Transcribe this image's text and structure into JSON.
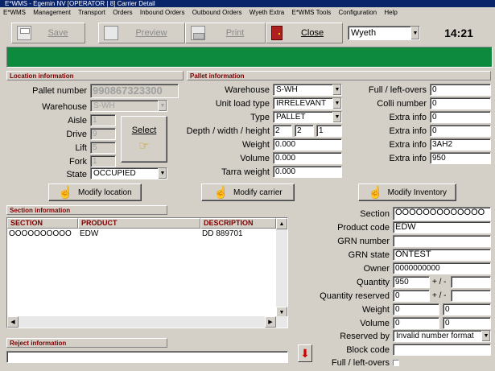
{
  "window": {
    "title": "E*WMS - Egemin NV [OPERATOR | 8] Carrier Detail"
  },
  "menu": [
    "E*WMS",
    "Management",
    "Transport",
    "Orders",
    "Inbound Orders",
    "Outbound Orders",
    "Wyeth Extra",
    "E*WMS Tools",
    "Configuration",
    "Help"
  ],
  "toolbar": {
    "save": "Save",
    "preview": "Preview",
    "print": "Print",
    "close": "Close",
    "client_value": "Wyeth",
    "clock": "14:21"
  },
  "location": {
    "title": "Location information",
    "pallet_number_label": "Pallet number",
    "pallet_number": "990867323300",
    "warehouse_label": "Warehouse",
    "warehouse": "S-WH",
    "aisle_label": "Aisle",
    "aisle": "1",
    "drive_label": "Drive",
    "drive": "9",
    "lift_label": "Lift",
    "lift": "5",
    "fork_label": "Fork",
    "fork": "1",
    "state_label": "State",
    "state": "OCCUPIED",
    "select_label": "Select"
  },
  "pallet": {
    "title": "Pallet information",
    "warehouse_label": "Warehouse",
    "warehouse": "S-WH",
    "unit_load_type_label": "Unit load type",
    "unit_load_type": "IRRELEVANT",
    "type_label": "Type",
    "type": "PALLET",
    "dims_label": "Depth / width / height",
    "depth": "2",
    "width": "2",
    "height": "1",
    "weight_label": "Weight",
    "weight": "0.000",
    "volume_label": "Volume",
    "volume": "0.000",
    "tarra_label": "Tarra weight",
    "tarra": "0.000"
  },
  "right_info": {
    "full_leftovers_label": "Full / left-overs",
    "full_leftovers": "0",
    "colli_label": "Colli number",
    "colli": "0",
    "extra1_label": "Extra info",
    "extra1": "0",
    "extra2_label": "Extra info",
    "extra2": "0",
    "extra3_label": "Extra info",
    "extra3": "3AH2",
    "extra4_label": "Extra info",
    "extra4": "950"
  },
  "actions": {
    "modify_location": "Modify location",
    "modify_carrier": "Modify carrier",
    "modify_inventory": "Modify Inventory"
  },
  "section_info": {
    "title": "Section information",
    "columns": [
      "SECTION",
      "PRODUCT",
      "DESCRIPTION"
    ],
    "rows": [
      {
        "section": "OOOOOOOOOO",
        "product": "EDW",
        "description": "DD 889701"
      }
    ]
  },
  "section_detail": {
    "section_label": "Section",
    "section": "OOOOOOOOOOOOO",
    "product_code_label": "Product code",
    "product_code": "EDW",
    "grn_number_label": "GRN number",
    "grn_number": "",
    "grn_state_label": "GRN state",
    "grn_state": "ONTEST",
    "owner_label": "Owner",
    "owner": "0000000000",
    "quantity_label": "Quantity",
    "quantity": "950",
    "quantity_tol": "+ / -",
    "quantity_reserved_label": "Quantity reserved",
    "quantity_reserved": "0",
    "quantity_reserved_tol": "+ / -",
    "weight_label": "Weight",
    "weight": "0",
    "weight2": "0",
    "volume_label": "Volume",
    "volume": "0",
    "volume2": "0",
    "reserved_by_label": "Reserved by",
    "reserved_by": "Invalid number format",
    "block_code_label": "Block code",
    "block_code": "",
    "full_leftovers_label": "Full / left-overs"
  },
  "reject": {
    "title": "Reject information",
    "value": ""
  }
}
